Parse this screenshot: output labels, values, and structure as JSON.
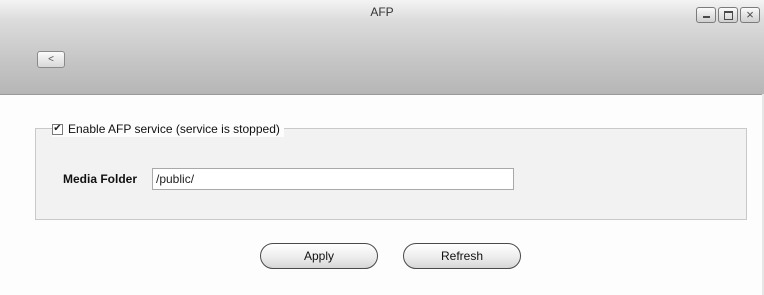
{
  "window": {
    "title": "AFP",
    "controls": [
      {
        "name": "minimize",
        "icon": "minimize-icon"
      },
      {
        "name": "maximize",
        "icon": "maximize-icon"
      },
      {
        "name": "close",
        "icon": "close-icon",
        "glyph": "×"
      }
    ]
  },
  "toolbar": {
    "back_glyph": "<",
    "back_icon": "chevron-left-icon"
  },
  "afp": {
    "enable_label": "Enable AFP service (service is stopped)",
    "enable_checked": true,
    "media_folder_label": "Media Folder",
    "media_folder_value": "/public/"
  },
  "actions": {
    "apply_label": "Apply",
    "refresh_label": "Refresh"
  }
}
